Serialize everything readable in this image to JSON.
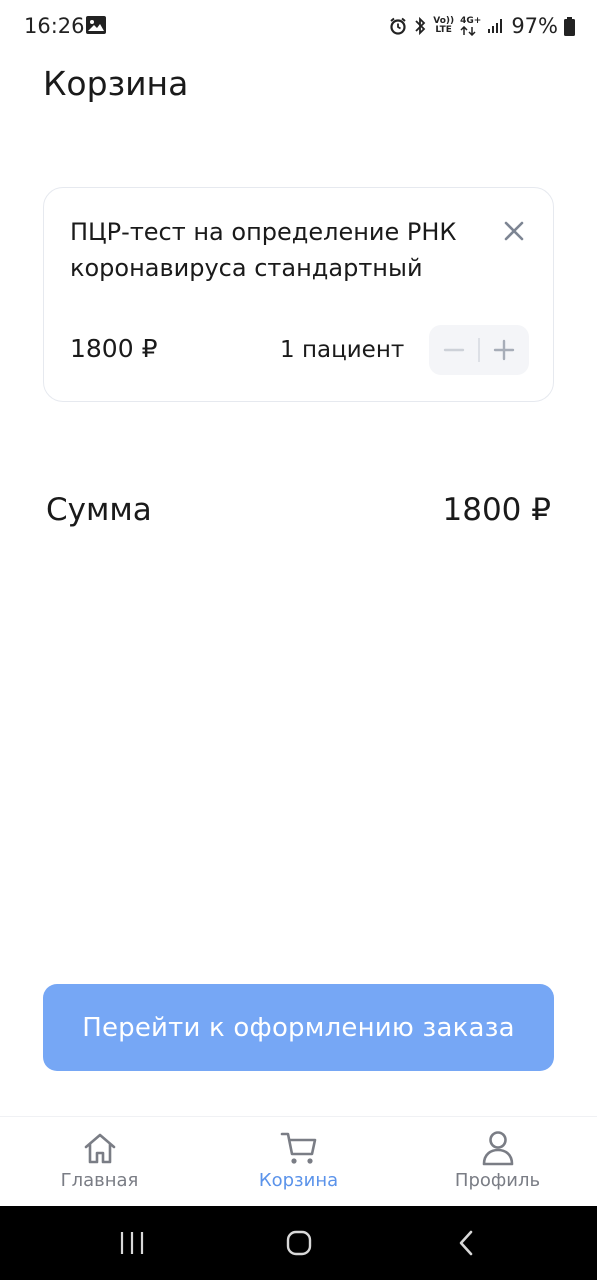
{
  "status_bar": {
    "time": "16:26",
    "network_top": "Vo))",
    "network_bottom": "LTE",
    "signal_type": "4G+",
    "battery": "97%",
    "icons": [
      "gallery-icon",
      "alarm-icon",
      "bluetooth-icon",
      "volte-icon",
      "data-arrows-icon",
      "signal-icon",
      "battery-icon"
    ]
  },
  "header": {
    "title": "Корзина"
  },
  "cart": {
    "items": [
      {
        "name": "ПЦР-тест на определение РНК коронавируса стандартный",
        "price": "1800 ₽",
        "patients": "1 пациент"
      }
    ]
  },
  "summary": {
    "label": "Сумма",
    "value": "1800 ₽"
  },
  "checkout": {
    "label": "Перейти к оформлению заказа",
    "color": "#76a7f5"
  },
  "bottom_nav": {
    "items": [
      {
        "label": "Главная",
        "icon": "home-icon",
        "active": false
      },
      {
        "label": "Корзина",
        "icon": "cart-icon",
        "active": true
      },
      {
        "label": "Профиль",
        "icon": "profile-icon",
        "active": false
      }
    ],
    "active_color": "#5b93ea",
    "inactive_color": "#7a7d85"
  },
  "system_nav": {
    "icons": [
      "recents-icon",
      "home-circle-icon",
      "back-icon"
    ]
  }
}
